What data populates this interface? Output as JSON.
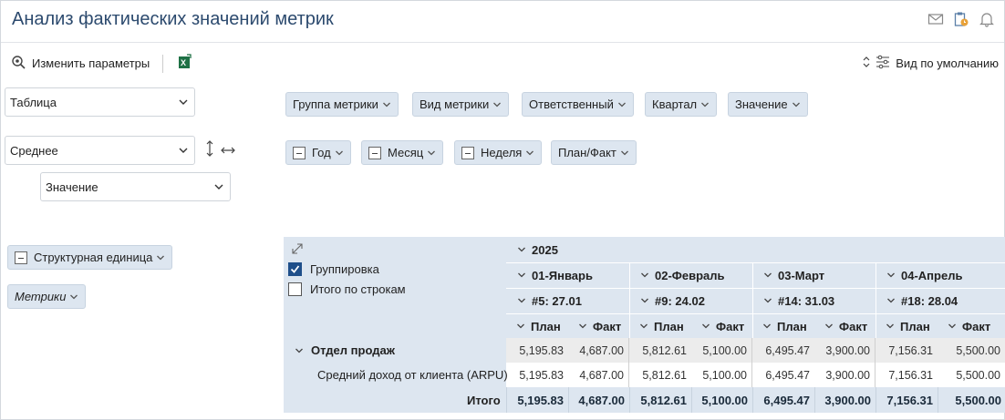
{
  "header": {
    "title": "Анализ фактических значений метрик"
  },
  "toolbar": {
    "change_params": "Изменить параметры",
    "default_view": "Вид по умолчанию"
  },
  "left_panel": {
    "view_select": "Таблица",
    "agg_select": "Среднее",
    "value_select": "Значение"
  },
  "filter_chips": [
    "Группа метрики",
    "Вид метрики",
    "Ответственный",
    "Квартал",
    "Значение"
  ],
  "column_chips": [
    "Год",
    "Месяц",
    "Неделя",
    "План/Факт"
  ],
  "row_chips": [
    "Структурная единица",
    "Метрики"
  ],
  "pivot": {
    "grouping_label": "Группировка",
    "row_totals_label": "Итого по строкам",
    "grouping_checked": true,
    "row_totals_checked": false,
    "year": "2025",
    "months": [
      "01-Январь",
      "02-Февраль",
      "03-Март",
      "04-Апрель"
    ],
    "weeks": [
      "#5: 27.01",
      "#9: 24.02",
      "#14: 31.03",
      "#18: 28.04"
    ],
    "measures": [
      "План",
      "Факт"
    ],
    "rows": [
      {
        "label": "Отдел продаж",
        "values": [
          "5,195.83",
          "4,687.00",
          "5,812.61",
          "5,100.00",
          "6,495.47",
          "3,900.00",
          "7,156.31",
          "5,500.00"
        ]
      },
      {
        "label": "Средний доход от клиента (ARPU)",
        "values": [
          "5,195.83",
          "4,687.00",
          "5,812.61",
          "5,100.00",
          "6,495.47",
          "3,900.00",
          "7,156.31",
          "5,500.00"
        ]
      }
    ],
    "total_label": "Итого",
    "totals": [
      "5,195.83",
      "4,687.00",
      "5,812.61",
      "5,100.00",
      "6,495.47",
      "3,900.00",
      "7,156.31",
      "5,500.00"
    ]
  },
  "colors": {
    "title": "#2c4a6e",
    "chip_bg": "#dde6f0",
    "checkbox": "#1f4f8a"
  }
}
